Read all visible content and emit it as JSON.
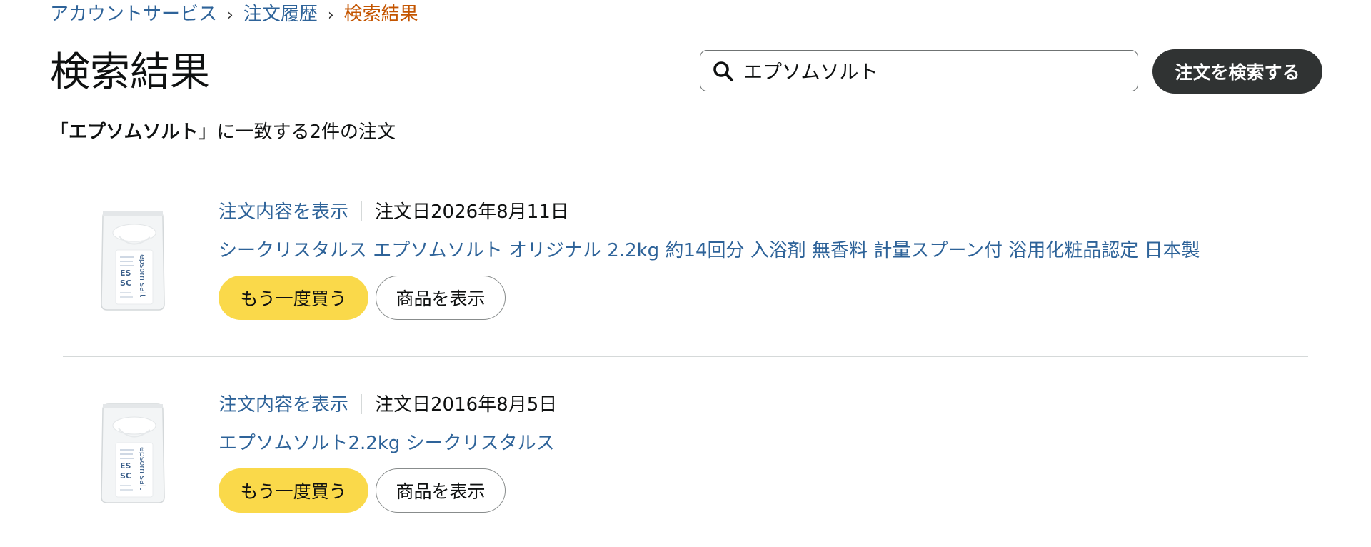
{
  "breadcrumb": {
    "items": [
      "アカウントサービス",
      "注文履歴"
    ],
    "current": "検索結果",
    "separator": "›"
  },
  "page_title": "検索結果",
  "search": {
    "value": "エプソムソルト",
    "button_label": "注文を検索する"
  },
  "summary": {
    "open_quote": "「",
    "query": "エプソムソルト",
    "rest": "」に一致する2件の注文"
  },
  "orders": [
    {
      "view_details_label": "注文内容を表示",
      "order_date": "注文日2026年8月11日",
      "product_title": "シークリスタルス エプソムソルト オリジナル 2.2kg 約14回分 入浴剤 無香料 計量スプーン付 浴用化粧品認定 日本製",
      "buy_again_label": "もう一度買う",
      "view_item_label": "商品を表示",
      "thumbnail_text": "epsom salt"
    },
    {
      "view_details_label": "注文内容を表示",
      "order_date": "注文日2016年8月5日",
      "product_title": "エプソムソルト2.2kg シークリスタルス",
      "buy_again_label": "もう一度買う",
      "view_item_label": "商品を表示",
      "thumbnail_text": "epsom salt"
    }
  ],
  "colors": {
    "link": "#2e6399",
    "current_breadcrumb": "#c45500",
    "buy_again_button": "#fad94a",
    "search_button": "#303333"
  }
}
